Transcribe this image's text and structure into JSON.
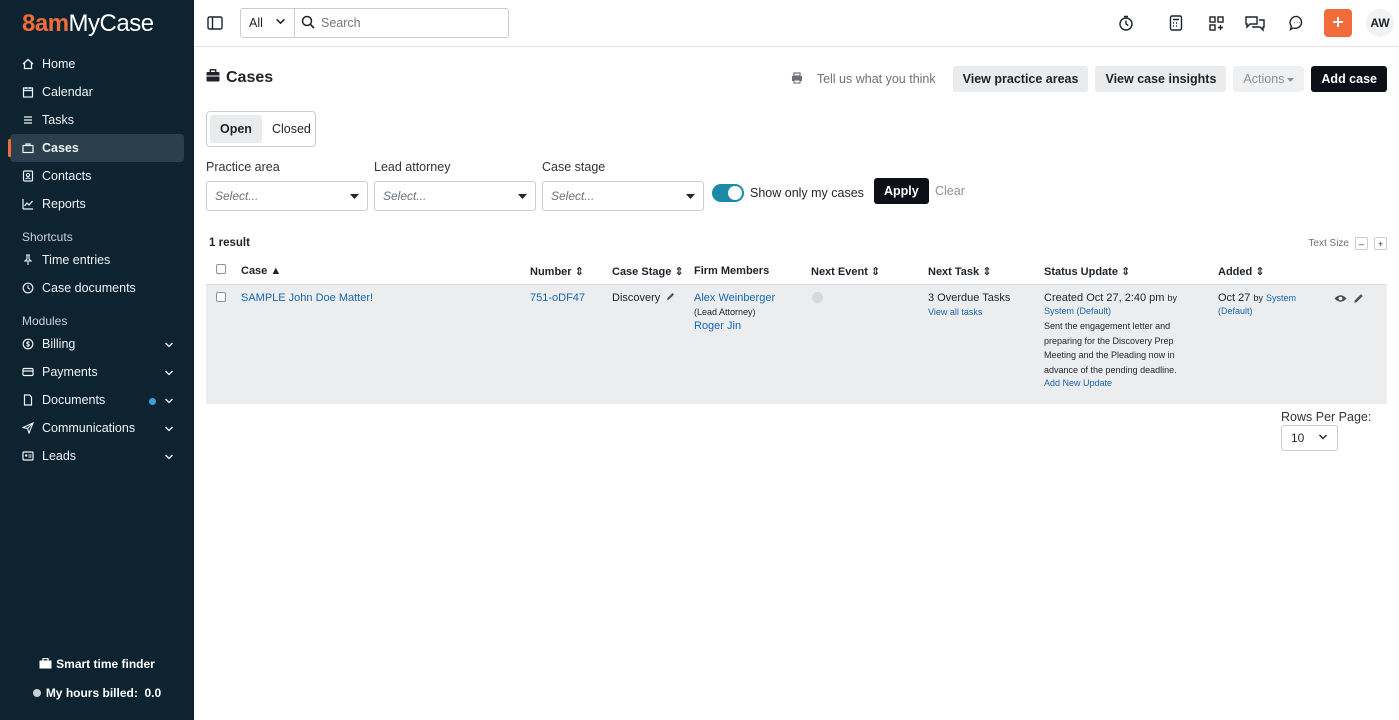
{
  "app": {
    "logo_prefix": "8am",
    "logo_suffix": "MyCase"
  },
  "sidebar": {
    "items": [
      {
        "label": "Home",
        "icon": "home-icon"
      },
      {
        "label": "Calendar",
        "icon": "calendar-icon"
      },
      {
        "label": "Tasks",
        "icon": "tasks-icon"
      },
      {
        "label": "Cases",
        "icon": "briefcase-icon",
        "active": true
      },
      {
        "label": "Contacts",
        "icon": "contacts-icon"
      },
      {
        "label": "Reports",
        "icon": "reports-icon"
      }
    ],
    "shortcuts_label": "Shortcuts",
    "shortcuts": [
      {
        "label": "Time entries",
        "icon": "pin-icon"
      },
      {
        "label": "Case documents",
        "icon": "clock-icon"
      }
    ],
    "modules_label": "Modules",
    "modules": [
      {
        "label": "Billing",
        "icon": "billing-icon"
      },
      {
        "label": "Payments",
        "icon": "payments-icon"
      },
      {
        "label": "Documents",
        "icon": "document-icon",
        "badge": true
      },
      {
        "label": "Communications",
        "icon": "send-icon"
      },
      {
        "label": "Leads",
        "icon": "leads-icon"
      }
    ],
    "smart_time_finder": "Smart time finder",
    "hours_billed_label": "My hours billed:",
    "hours_billed_value": "0.0"
  },
  "topbar": {
    "search_scope": "All",
    "search_placeholder": "Search",
    "avatar_initials": "AW"
  },
  "header": {
    "title": "Cases",
    "feedback": "Tell us what you think",
    "view_practice_areas": "View practice areas",
    "view_case_insights": "View case insights",
    "actions": "Actions",
    "add_case": "Add case"
  },
  "filters": {
    "tabs": [
      "Open",
      "Closed"
    ],
    "practice_area_label": "Practice area",
    "lead_attorney_label": "Lead attorney",
    "case_stage_label": "Case stage",
    "select_placeholder": "Select...",
    "show_only_mine": "Show only my cases",
    "apply": "Apply",
    "clear": "Clear"
  },
  "results": {
    "count": "1 result",
    "text_size": "Text Size",
    "minus": "–",
    "plus": "+"
  },
  "table": {
    "columns": [
      "Case",
      "Number",
      "Case Stage",
      "Firm Members",
      "Next Event",
      "Next Task",
      "Status Update",
      "Added"
    ],
    "row": {
      "case": "SAMPLE John Doe Matter!",
      "number": "751-oDF47",
      "stage": "Discovery",
      "member1": "Alex Weinberger",
      "member1_role": "(Lead Attorney)",
      "member2": "Roger Jin",
      "next_task": "3 Overdue Tasks",
      "view_all_tasks": "View all tasks",
      "status_created": "Created Oct 27, 2:40 pm",
      "status_by": "by",
      "status_author": "System (Default)",
      "status_text": "Sent the engagement letter and preparing for the Discovery Prep Meeting and the Pleading now in advance of the pending deadline.",
      "add_update": "Add New Update",
      "added_date": "Oct 27",
      "added_by": "by",
      "added_author_1": "System",
      "added_author_2": "(Default)"
    }
  },
  "pagination": {
    "rows_per_page_label": "Rows Per Page:",
    "rows_per_page_value": "10"
  },
  "colors": {
    "sidebar_bg": "#0d2330",
    "accent": "#f26b3a",
    "link": "#1766b0",
    "toggle": "#1b8aa8"
  }
}
